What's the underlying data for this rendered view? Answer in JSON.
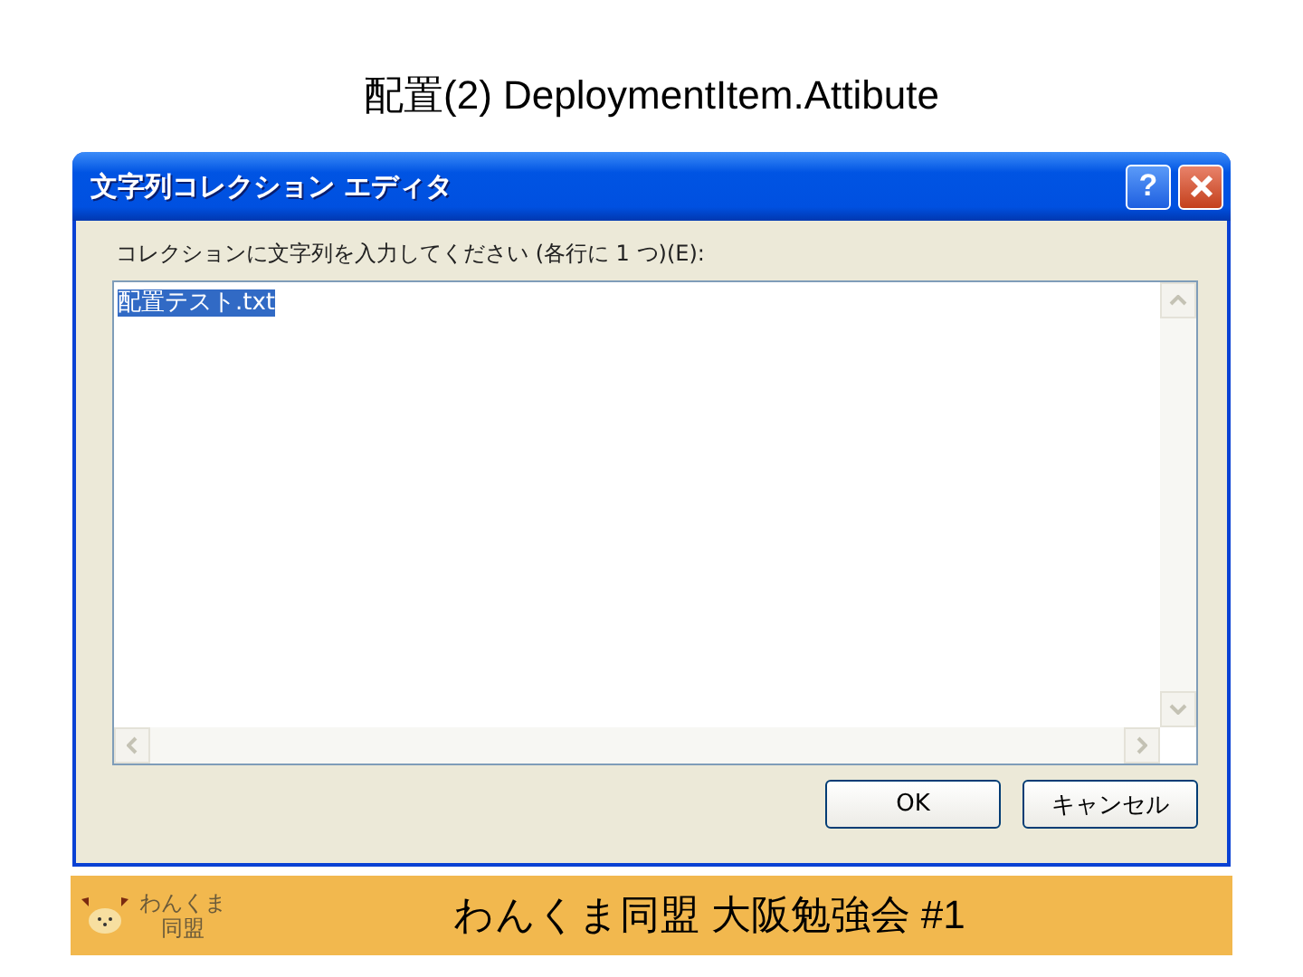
{
  "slide_title": "配置(2) DeploymentItem.Attibute",
  "window": {
    "title": "文字列コレクション エディタ",
    "help_button": "?"
  },
  "prompt": "コレクションに文字列を入力してください (各行に 1 つ)(E):",
  "editor": {
    "lines": [
      {
        "text": "配置テスト.txt",
        "selected": true
      }
    ]
  },
  "buttons": [
    {
      "label": "OK"
    },
    {
      "label": "キャンセル"
    }
  ],
  "footer": {
    "logo_lines": [
      "わんくま",
      "同盟"
    ],
    "text": "わんくま同盟 大阪勉強会 #1"
  }
}
